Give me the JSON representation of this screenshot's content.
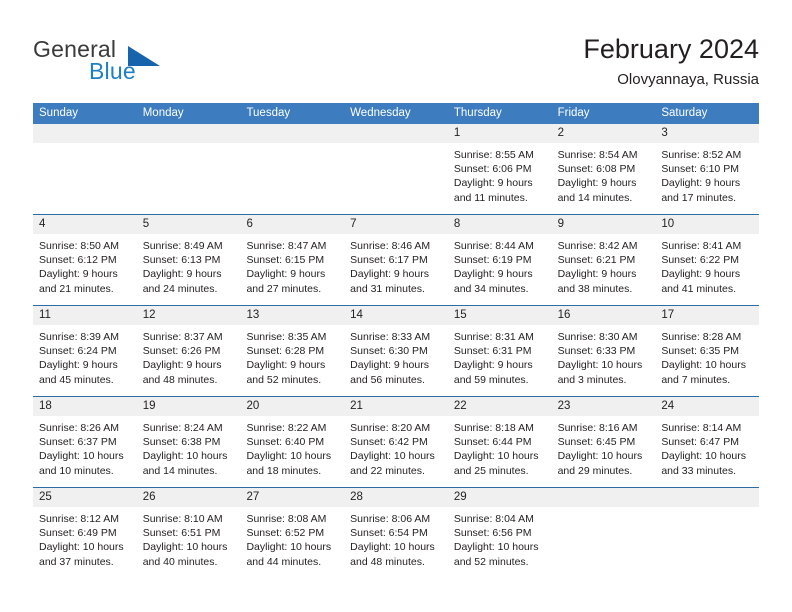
{
  "brand": {
    "name_part1": "General",
    "name_part2": "Blue",
    "triangle_icon": "brand-triangle-icon",
    "color_dark": "#3a3a3a",
    "color_blue": "#1f7fc4",
    "color_triangle": "#1763ac"
  },
  "header": {
    "month_title": "February 2024",
    "location": "Olovyannaya, Russia"
  },
  "theme": {
    "header_blue": "#3c7cbf",
    "row_divider_blue": "#2c6da8",
    "date_band_gray": "#f0f0f0",
    "text_color": "#231f20"
  },
  "weekdays": [
    {
      "label": "Sunday"
    },
    {
      "label": "Monday"
    },
    {
      "label": "Tuesday"
    },
    {
      "label": "Wednesday"
    },
    {
      "label": "Thursday"
    },
    {
      "label": "Friday"
    },
    {
      "label": "Saturday"
    }
  ],
  "weeks": [
    {
      "days": [
        {
          "date": "",
          "lines": []
        },
        {
          "date": "",
          "lines": []
        },
        {
          "date": "",
          "lines": []
        },
        {
          "date": "",
          "lines": []
        },
        {
          "date": "1",
          "lines": [
            "Sunrise: 8:55 AM",
            "Sunset: 6:06 PM",
            "Daylight: 9 hours",
            "and 11 minutes."
          ]
        },
        {
          "date": "2",
          "lines": [
            "Sunrise: 8:54 AM",
            "Sunset: 6:08 PM",
            "Daylight: 9 hours",
            "and 14 minutes."
          ]
        },
        {
          "date": "3",
          "lines": [
            "Sunrise: 8:52 AM",
            "Sunset: 6:10 PM",
            "Daylight: 9 hours",
            "and 17 minutes."
          ]
        }
      ]
    },
    {
      "days": [
        {
          "date": "4",
          "lines": [
            "Sunrise: 8:50 AM",
            "Sunset: 6:12 PM",
            "Daylight: 9 hours",
            "and 21 minutes."
          ]
        },
        {
          "date": "5",
          "lines": [
            "Sunrise: 8:49 AM",
            "Sunset: 6:13 PM",
            "Daylight: 9 hours",
            "and 24 minutes."
          ]
        },
        {
          "date": "6",
          "lines": [
            "Sunrise: 8:47 AM",
            "Sunset: 6:15 PM",
            "Daylight: 9 hours",
            "and 27 minutes."
          ]
        },
        {
          "date": "7",
          "lines": [
            "Sunrise: 8:46 AM",
            "Sunset: 6:17 PM",
            "Daylight: 9 hours",
            "and 31 minutes."
          ]
        },
        {
          "date": "8",
          "lines": [
            "Sunrise: 8:44 AM",
            "Sunset: 6:19 PM",
            "Daylight: 9 hours",
            "and 34 minutes."
          ]
        },
        {
          "date": "9",
          "lines": [
            "Sunrise: 8:42 AM",
            "Sunset: 6:21 PM",
            "Daylight: 9 hours",
            "and 38 minutes."
          ]
        },
        {
          "date": "10",
          "lines": [
            "Sunrise: 8:41 AM",
            "Sunset: 6:22 PM",
            "Daylight: 9 hours",
            "and 41 minutes."
          ]
        }
      ]
    },
    {
      "days": [
        {
          "date": "11",
          "lines": [
            "Sunrise: 8:39 AM",
            "Sunset: 6:24 PM",
            "Daylight: 9 hours",
            "and 45 minutes."
          ]
        },
        {
          "date": "12",
          "lines": [
            "Sunrise: 8:37 AM",
            "Sunset: 6:26 PM",
            "Daylight: 9 hours",
            "and 48 minutes."
          ]
        },
        {
          "date": "13",
          "lines": [
            "Sunrise: 8:35 AM",
            "Sunset: 6:28 PM",
            "Daylight: 9 hours",
            "and 52 minutes."
          ]
        },
        {
          "date": "14",
          "lines": [
            "Sunrise: 8:33 AM",
            "Sunset: 6:30 PM",
            "Daylight: 9 hours",
            "and 56 minutes."
          ]
        },
        {
          "date": "15",
          "lines": [
            "Sunrise: 8:31 AM",
            "Sunset: 6:31 PM",
            "Daylight: 9 hours",
            "and 59 minutes."
          ]
        },
        {
          "date": "16",
          "lines": [
            "Sunrise: 8:30 AM",
            "Sunset: 6:33 PM",
            "Daylight: 10 hours",
            "and 3 minutes."
          ]
        },
        {
          "date": "17",
          "lines": [
            "Sunrise: 8:28 AM",
            "Sunset: 6:35 PM",
            "Daylight: 10 hours",
            "and 7 minutes."
          ]
        }
      ]
    },
    {
      "days": [
        {
          "date": "18",
          "lines": [
            "Sunrise: 8:26 AM",
            "Sunset: 6:37 PM",
            "Daylight: 10 hours",
            "and 10 minutes."
          ]
        },
        {
          "date": "19",
          "lines": [
            "Sunrise: 8:24 AM",
            "Sunset: 6:38 PM",
            "Daylight: 10 hours",
            "and 14 minutes."
          ]
        },
        {
          "date": "20",
          "lines": [
            "Sunrise: 8:22 AM",
            "Sunset: 6:40 PM",
            "Daylight: 10 hours",
            "and 18 minutes."
          ]
        },
        {
          "date": "21",
          "lines": [
            "Sunrise: 8:20 AM",
            "Sunset: 6:42 PM",
            "Daylight: 10 hours",
            "and 22 minutes."
          ]
        },
        {
          "date": "22",
          "lines": [
            "Sunrise: 8:18 AM",
            "Sunset: 6:44 PM",
            "Daylight: 10 hours",
            "and 25 minutes."
          ]
        },
        {
          "date": "23",
          "lines": [
            "Sunrise: 8:16 AM",
            "Sunset: 6:45 PM",
            "Daylight: 10 hours",
            "and 29 minutes."
          ]
        },
        {
          "date": "24",
          "lines": [
            "Sunrise: 8:14 AM",
            "Sunset: 6:47 PM",
            "Daylight: 10 hours",
            "and 33 minutes."
          ]
        }
      ]
    },
    {
      "days": [
        {
          "date": "25",
          "lines": [
            "Sunrise: 8:12 AM",
            "Sunset: 6:49 PM",
            "Daylight: 10 hours",
            "and 37 minutes."
          ]
        },
        {
          "date": "26",
          "lines": [
            "Sunrise: 8:10 AM",
            "Sunset: 6:51 PM",
            "Daylight: 10 hours",
            "and 40 minutes."
          ]
        },
        {
          "date": "27",
          "lines": [
            "Sunrise: 8:08 AM",
            "Sunset: 6:52 PM",
            "Daylight: 10 hours",
            "and 44 minutes."
          ]
        },
        {
          "date": "28",
          "lines": [
            "Sunrise: 8:06 AM",
            "Sunset: 6:54 PM",
            "Daylight: 10 hours",
            "and 48 minutes."
          ]
        },
        {
          "date": "29",
          "lines": [
            "Sunrise: 8:04 AM",
            "Sunset: 6:56 PM",
            "Daylight: 10 hours",
            "and 52 minutes."
          ]
        },
        {
          "date": "",
          "lines": []
        },
        {
          "date": "",
          "lines": []
        }
      ]
    }
  ]
}
